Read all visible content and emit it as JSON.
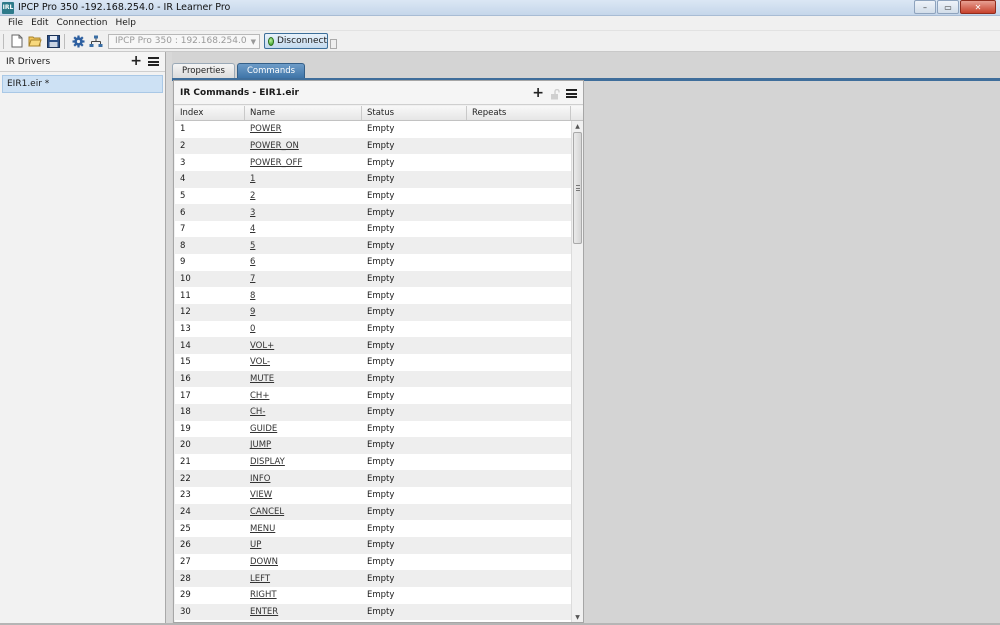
{
  "window": {
    "app_icon_text": "IRL",
    "title": "IPCP Pro 350 -192.168.254.0 - IR Learner Pro",
    "minimize": "–",
    "maximize": "▭",
    "close": "✕"
  },
  "menu": [
    "File",
    "Edit",
    "Connection",
    "Help"
  ],
  "toolbar": {
    "device_select_value": "IPCP Pro 350 : 192.168.254.0",
    "disconnect_label": "Disconnect"
  },
  "left_panel": {
    "title": "IR Drivers",
    "items": [
      {
        "label": "EIR1.eir *"
      }
    ]
  },
  "tabs": [
    {
      "label": "Properties",
      "active": false
    },
    {
      "label": "Commands",
      "active": true
    }
  ],
  "commands_panel": {
    "title": "IR Commands - EIR1.eir",
    "columns": [
      "Index",
      "Name",
      "Status",
      "Repeats"
    ],
    "rows": [
      {
        "index": "1",
        "name": "POWER",
        "status": "Empty",
        "repeats": ""
      },
      {
        "index": "2",
        "name": "POWER_ON",
        "status": "Empty",
        "repeats": ""
      },
      {
        "index": "3",
        "name": "POWER_OFF",
        "status": "Empty",
        "repeats": ""
      },
      {
        "index": "4",
        "name": "1",
        "status": "Empty",
        "repeats": ""
      },
      {
        "index": "5",
        "name": "2",
        "status": "Empty",
        "repeats": ""
      },
      {
        "index": "6",
        "name": "3",
        "status": "Empty",
        "repeats": ""
      },
      {
        "index": "7",
        "name": "4",
        "status": "Empty",
        "repeats": ""
      },
      {
        "index": "8",
        "name": "5",
        "status": "Empty",
        "repeats": ""
      },
      {
        "index": "9",
        "name": "6",
        "status": "Empty",
        "repeats": ""
      },
      {
        "index": "10",
        "name": "7",
        "status": "Empty",
        "repeats": ""
      },
      {
        "index": "11",
        "name": "8",
        "status": "Empty",
        "repeats": ""
      },
      {
        "index": "12",
        "name": "9",
        "status": "Empty",
        "repeats": ""
      },
      {
        "index": "13",
        "name": "0",
        "status": "Empty",
        "repeats": ""
      },
      {
        "index": "14",
        "name": "VOL+",
        "status": "Empty",
        "repeats": ""
      },
      {
        "index": "15",
        "name": "VOL-",
        "status": "Empty",
        "repeats": ""
      },
      {
        "index": "16",
        "name": "MUTE",
        "status": "Empty",
        "repeats": ""
      },
      {
        "index": "17",
        "name": "CH+",
        "status": "Empty",
        "repeats": ""
      },
      {
        "index": "18",
        "name": "CH-",
        "status": "Empty",
        "repeats": ""
      },
      {
        "index": "19",
        "name": "GUIDE",
        "status": "Empty",
        "repeats": ""
      },
      {
        "index": "20",
        "name": "JUMP",
        "status": "Empty",
        "repeats": ""
      },
      {
        "index": "21",
        "name": "DISPLAY",
        "status": "Empty",
        "repeats": ""
      },
      {
        "index": "22",
        "name": "INFO",
        "status": "Empty",
        "repeats": ""
      },
      {
        "index": "23",
        "name": "VIEW",
        "status": "Empty",
        "repeats": ""
      },
      {
        "index": "24",
        "name": "CANCEL",
        "status": "Empty",
        "repeats": ""
      },
      {
        "index": "25",
        "name": "MENU",
        "status": "Empty",
        "repeats": ""
      },
      {
        "index": "26",
        "name": "UP",
        "status": "Empty",
        "repeats": ""
      },
      {
        "index": "27",
        "name": "DOWN",
        "status": "Empty",
        "repeats": ""
      },
      {
        "index": "28",
        "name": "LEFT",
        "status": "Empty",
        "repeats": ""
      },
      {
        "index": "29",
        "name": "RIGHT",
        "status": "Empty",
        "repeats": ""
      },
      {
        "index": "30",
        "name": "ENTER",
        "status": "Empty",
        "repeats": ""
      }
    ]
  },
  "colors": {
    "tab_active": "#3f75a8",
    "selection": "#cde1f4",
    "connected": "#2f9a1c"
  }
}
